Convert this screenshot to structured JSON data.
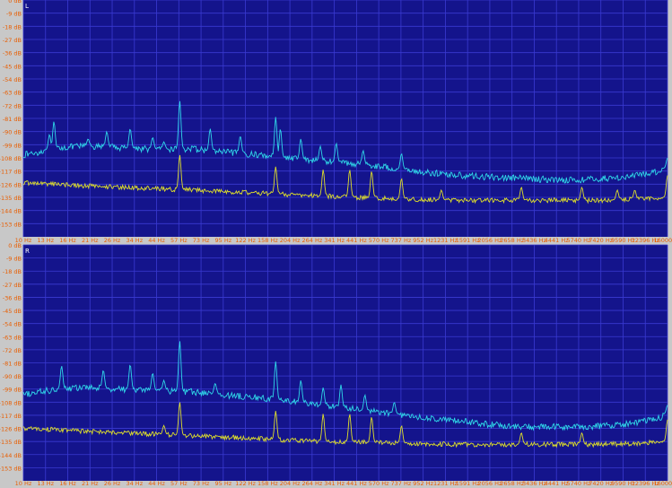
{
  "theme": {
    "background": "#c8c8c8",
    "plot_background": "#14148c",
    "grid": "#3a3ad2",
    "axis_text_y": "#e85d00",
    "axis_text_x": "#e85d00",
    "series_colors": [
      "#2fd7e8",
      "#dede2a"
    ]
  },
  "chart_data": [
    {
      "type": "line",
      "channel": "L",
      "x_scale": "log",
      "xlim": [
        10,
        16000
      ],
      "ylim": [
        -162,
        0
      ],
      "grid": true,
      "y_ticks": [
        "0 dB",
        "-9 dB",
        "-18 dB",
        "-27 dB",
        "-36 dB",
        "-45 dB",
        "-54 dB",
        "-63 dB",
        "-72 dB",
        "-81 dB",
        "-90 dB",
        "-99 dB",
        "-108 dB",
        "-117 dB",
        "-126 dB",
        "-135 dB",
        "-144 dB",
        "-153 dB"
      ],
      "x_ticks": [
        "10 Hz",
        "13 Hz",
        "16 Hz",
        "21 Hz",
        "26 Hz",
        "34 Hz",
        "44 Hz",
        "57 Hz",
        "73 Hz",
        "95 Hz",
        "122 Hz",
        "158 Hz",
        "204 Hz",
        "264 Hz",
        "341 Hz",
        "441 Hz",
        "570 Hz",
        "737 Hz",
        "952 Hz",
        "1231 Hz",
        "1591 Hz",
        "2056 Hz",
        "2658 Hz",
        "3436 Hz",
        "4441 Hz",
        "5740 Hz",
        "7420 Hz",
        "9590 Hz",
        "12396 Hz",
        "16000 Hz"
      ],
      "series": [
        {
          "color": "cyan",
          "noise_amp": 2.2,
          "x": [
            10,
            12,
            15,
            20,
            30,
            45,
            70,
            100,
            150,
            200,
            300,
            450,
            700,
            1000,
            1500,
            2000,
            3000,
            4500,
            6000,
            8000,
            10000,
            12500,
            14500,
            16000
          ],
          "y": [
            -106,
            -104,
            -101,
            -100,
            -101,
            -102,
            -102,
            -104,
            -106,
            -108,
            -110,
            -112,
            -115,
            -118,
            -120,
            -121,
            -122,
            -123,
            -123,
            -122,
            -121,
            -119,
            -117,
            -115
          ],
          "peaks": [
            {
              "x": 13.5,
              "y": -92
            },
            {
              "x": 14.2,
              "y": -83
            },
            {
              "x": 21,
              "y": -95
            },
            {
              "x": 26,
              "y": -90
            },
            {
              "x": 34,
              "y": -88
            },
            {
              "x": 44,
              "y": -94
            },
            {
              "x": 50,
              "y": -97
            },
            {
              "x": 60,
              "y": -69
            },
            {
              "x": 85,
              "y": -88
            },
            {
              "x": 120,
              "y": -93
            },
            {
              "x": 180,
              "y": -80
            },
            {
              "x": 190,
              "y": -88
            },
            {
              "x": 240,
              "y": -95
            },
            {
              "x": 300,
              "y": -100
            },
            {
              "x": 360,
              "y": -98
            },
            {
              "x": 490,
              "y": -103
            },
            {
              "x": 760,
              "y": -105
            },
            {
              "x": 16000,
              "y": -108
            }
          ]
        },
        {
          "color": "yellow",
          "noise_amp": 1.6,
          "x": [
            10,
            15,
            20,
            30,
            45,
            70,
            100,
            150,
            200,
            300,
            450,
            700,
            1000,
            1500,
            2000,
            3000,
            4500,
            6000,
            8000,
            10000,
            12500,
            14500,
            16000
          ],
          "y": [
            -125,
            -126,
            -127,
            -128,
            -129,
            -130,
            -131,
            -132,
            -133,
            -134,
            -135,
            -136,
            -136.5,
            -137,
            -137,
            -137,
            -137,
            -137,
            -137,
            -136.5,
            -136,
            -135.5,
            -135
          ],
          "peaks": [
            {
              "x": 60,
              "y": -106
            },
            {
              "x": 180,
              "y": -114
            },
            {
              "x": 310,
              "y": -116
            },
            {
              "x": 420,
              "y": -116
            },
            {
              "x": 540,
              "y": -117
            },
            {
              "x": 760,
              "y": -122
            },
            {
              "x": 1200,
              "y": -130
            },
            {
              "x": 3000,
              "y": -128
            },
            {
              "x": 6000,
              "y": -128
            },
            {
              "x": 9000,
              "y": -130
            },
            {
              "x": 11000,
              "y": -130
            },
            {
              "x": 16000,
              "y": -120
            }
          ]
        }
      ]
    },
    {
      "type": "line",
      "channel": "R",
      "x_scale": "log",
      "xlim": [
        10,
        16000
      ],
      "ylim": [
        -162,
        0
      ],
      "grid": true,
      "y_ticks": [
        "0 dB",
        "-9 dB",
        "-18 dB",
        "-27 dB",
        "-36 dB",
        "-45 dB",
        "-54 dB",
        "-63 dB",
        "-72 dB",
        "-81 dB",
        "-90 dB",
        "-99 dB",
        "-108 dB",
        "-117 dB",
        "-126 dB",
        "-135 dB",
        "-144 dB",
        "-153 dB"
      ],
      "x_ticks": [
        "10 Hz",
        "13 Hz",
        "16 Hz",
        "21 Hz",
        "26 Hz",
        "34 Hz",
        "44 Hz",
        "57 Hz",
        "73 Hz",
        "95 Hz",
        "122 Hz",
        "158 Hz",
        "204 Hz",
        "264 Hz",
        "341 Hz",
        "441 Hz",
        "570 Hz",
        "737 Hz",
        "952 Hz",
        "1231 Hz",
        "1591 Hz",
        "2056 Hz",
        "2658 Hz",
        "3436 Hz",
        "4441 Hz",
        "5740 Hz",
        "7420 Hz",
        "9590 Hz",
        "12396 Hz",
        "16000 Hz"
      ],
      "series": [
        {
          "color": "cyan",
          "noise_amp": 2.2,
          "x": [
            10,
            12,
            15,
            20,
            30,
            45,
            70,
            100,
            150,
            200,
            300,
            450,
            700,
            1000,
            1500,
            2000,
            3000,
            4500,
            6000,
            8000,
            10000,
            12500,
            14500,
            16000
          ],
          "y": [
            -103,
            -101,
            -99,
            -98,
            -99,
            -100,
            -101,
            -103,
            -105,
            -107,
            -110,
            -113,
            -116,
            -119,
            -121,
            -123,
            -125,
            -125,
            -125,
            -124,
            -123,
            -121,
            -119,
            -116
          ],
          "peaks": [
            {
              "x": 15.5,
              "y": -83
            },
            {
              "x": 25,
              "y": -86
            },
            {
              "x": 34,
              "y": -82
            },
            {
              "x": 44,
              "y": -88
            },
            {
              "x": 50,
              "y": -93
            },
            {
              "x": 60,
              "y": -66
            },
            {
              "x": 90,
              "y": -95
            },
            {
              "x": 180,
              "y": -80
            },
            {
              "x": 240,
              "y": -93
            },
            {
              "x": 310,
              "y": -98
            },
            {
              "x": 380,
              "y": -96
            },
            {
              "x": 500,
              "y": -103
            },
            {
              "x": 700,
              "y": -108
            },
            {
              "x": 16000,
              "y": -110
            }
          ]
        },
        {
          "color": "yellow",
          "noise_amp": 1.6,
          "x": [
            10,
            15,
            20,
            30,
            45,
            70,
            100,
            150,
            200,
            300,
            450,
            700,
            1000,
            1500,
            2000,
            3000,
            4500,
            6000,
            8000,
            10000,
            12500,
            14500,
            16000
          ],
          "y": [
            -126,
            -127,
            -128,
            -129,
            -130,
            -131,
            -132,
            -133,
            -134,
            -135,
            -135.5,
            -136,
            -136.5,
            -137,
            -137,
            -137,
            -137,
            -137,
            -137,
            -136.5,
            -136,
            -135.5,
            -135
          ],
          "peaks": [
            {
              "x": 50,
              "y": -124
            },
            {
              "x": 60,
              "y": -108
            },
            {
              "x": 180,
              "y": -114
            },
            {
              "x": 310,
              "y": -116
            },
            {
              "x": 420,
              "y": -116
            },
            {
              "x": 540,
              "y": -118
            },
            {
              "x": 760,
              "y": -124
            },
            {
              "x": 3000,
              "y": -129
            },
            {
              "x": 6000,
              "y": -129
            },
            {
              "x": 16000,
              "y": -120
            }
          ]
        }
      ]
    }
  ]
}
